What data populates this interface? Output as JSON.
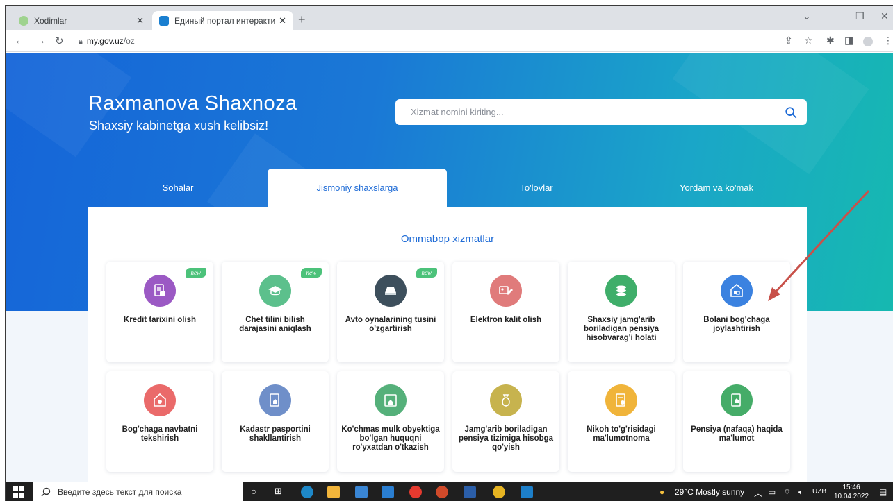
{
  "browser": {
    "tabs": [
      {
        "title": "Xodimlar",
        "active": false
      },
      {
        "title": "Единый портал интерактивных",
        "active": true
      }
    ],
    "new_tab": "+",
    "url_host": "my.gov.uz",
    "url_path": "/oz"
  },
  "hero": {
    "user_name": "Raxmanova Shaxnoza",
    "welcome": "Shaxsiy kabinetga xush kelibsiz!",
    "search_placeholder": "Xizmat nomini kiriting..."
  },
  "nav_tabs": [
    {
      "label": "Sohalar",
      "active": false
    },
    {
      "label": "Jismoniy shaxslarga",
      "active": true
    },
    {
      "label": "To'lovlar",
      "active": false
    },
    {
      "label": "Yordam va ko'mak",
      "active": false
    }
  ],
  "section_title": "Ommabop xizmatlar",
  "badge_text": "new",
  "services": [
    {
      "label": "Kredit tarixini olish",
      "icon": "credit-document-icon",
      "color": "#9b59c4",
      "new": true
    },
    {
      "label": "Chet tilini bilish darajasini aniqlash",
      "icon": "graduation-cap-icon",
      "color": "#5cc08c",
      "new": true
    },
    {
      "label": "Avto oynalarining tusini o'zgartirish",
      "icon": "car-window-icon",
      "color": "#3d4f5c",
      "new": true
    },
    {
      "label": "Elektron kalit olish",
      "icon": "electronic-key-icon",
      "color": "#e07b7b",
      "new": false
    },
    {
      "label": "Shaxsiy jamg'arib boriladigan pensiya hisobvarag'i holati",
      "icon": "coins-icon",
      "color": "#3fae6a",
      "new": false
    },
    {
      "label": "Bolani bog'chaga joylashtirish",
      "icon": "kindergarten-blocks-icon",
      "color": "#3b82e0",
      "new": false
    },
    {
      "label": "Bog'chaga navbatni tekshirish",
      "icon": "kindergarten-queue-icon",
      "color": "#ea6a6a",
      "new": false
    },
    {
      "label": "Kadastr pasportini shakllantirish",
      "icon": "cadastre-passport-icon",
      "color": "#6f8fc9",
      "new": false
    },
    {
      "label": "Ko'chmas mulk obyektiga bo'lgan huquqni ro'yxatdan o'tkazish",
      "icon": "real-estate-icon",
      "color": "#55b07a",
      "new": false
    },
    {
      "label": "Jamg'arib boriladigan pensiya tizimiga hisobga qo'yish",
      "icon": "money-bag-icon",
      "color": "#c7b34e",
      "new": false
    },
    {
      "label": "Nikoh to'g'risidagi ma'lumotnoma",
      "icon": "marriage-certificate-icon",
      "color": "#f0b43a",
      "new": false
    },
    {
      "label": "Pensiya (nafaqa) haqida ma'lumot",
      "icon": "pension-info-icon",
      "color": "#45ac68",
      "new": false
    }
  ],
  "taskbar": {
    "search_text": "Введите здесь текст для поиска",
    "weather": "29°C  Mostly sunny",
    "language": "UZB",
    "time": "15:46",
    "date": "10.04.2022"
  }
}
